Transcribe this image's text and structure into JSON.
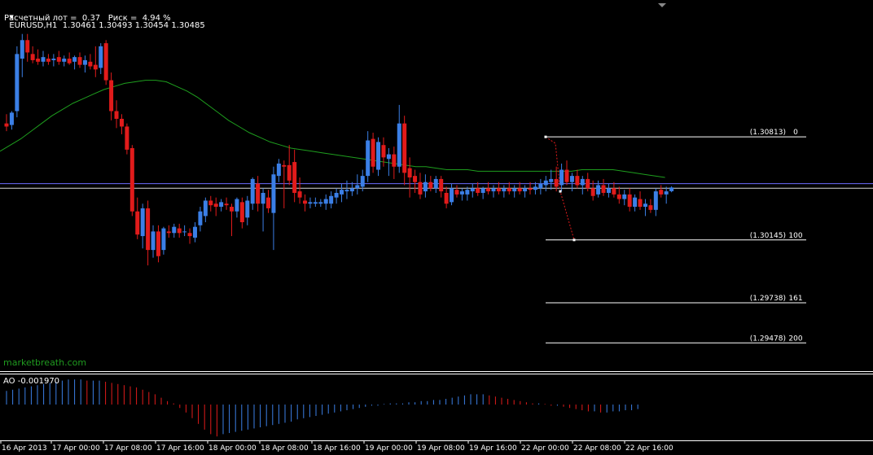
{
  "header": {
    "symbol_line": "EURUSD,H1  1.30461 1.30493 1.30454 1.30485",
    "risk_line": "Расчетный лот =  0.37   Риск =  4.94 %"
  },
  "watermark": "marketbreath.com",
  "indicator": {
    "label": "AO -0.001970"
  },
  "colors": {
    "background": "#000000",
    "bull": "#3b7fe6",
    "bear": "#e11b1b",
    "ma": "#1e9e1e",
    "hline_blue": "#6b6bff",
    "hline_white": "#d8d8d8",
    "grid": "#ffffff"
  },
  "chart_data": {
    "type": "candlestick",
    "symbol": "EURUSD",
    "timeframe": "H1",
    "current_ohlc": {
      "open": 1.30461,
      "high": 1.30493,
      "low": 1.30454,
      "close": 1.30485
    },
    "x_tick_labels": [
      "16 Apr 2013",
      "17 Apr 00:00",
      "17 Apr 08:00",
      "17 Apr 16:00",
      "18 Apr 00:00",
      "18 Apr 08:00",
      "18 Apr 16:00",
      "19 Apr 00:00",
      "19 Apr 08:00",
      "19 Apr 16:00",
      "22 Apr 00:00",
      "22 Apr 08:00",
      "22 Apr 16:00"
    ],
    "ylim": [
      1.293,
      1.317
    ],
    "candles": [
      {
        "o": 1.309,
        "h": 1.3096,
        "l": 1.3085,
        "c": 1.3088
      },
      {
        "o": 1.3089,
        "h": 1.3098,
        "l": 1.3086,
        "c": 1.3097
      },
      {
        "o": 1.3098,
        "h": 1.314,
        "l": 1.3094,
        "c": 1.3135
      },
      {
        "o": 1.3132,
        "h": 1.3148,
        "l": 1.312,
        "c": 1.3144
      },
      {
        "o": 1.3144,
        "h": 1.3148,
        "l": 1.313,
        "c": 1.3136
      },
      {
        "o": 1.3135,
        "h": 1.314,
        "l": 1.3129,
        "c": 1.3131
      },
      {
        "o": 1.3132,
        "h": 1.3138,
        "l": 1.3128,
        "c": 1.313
      },
      {
        "o": 1.313,
        "h": 1.3137,
        "l": 1.3127,
        "c": 1.3133
      },
      {
        "o": 1.3132,
        "h": 1.3135,
        "l": 1.3128,
        "c": 1.313
      },
      {
        "o": 1.3131,
        "h": 1.3135,
        "l": 1.3127,
        "c": 1.3132
      },
      {
        "o": 1.3133,
        "h": 1.3137,
        "l": 1.3128,
        "c": 1.313
      },
      {
        "o": 1.313,
        "h": 1.3134,
        "l": 1.3127,
        "c": 1.3132
      },
      {
        "o": 1.3132,
        "h": 1.3136,
        "l": 1.3128,
        "c": 1.3129
      },
      {
        "o": 1.313,
        "h": 1.3134,
        "l": 1.3125,
        "c": 1.3133
      },
      {
        "o": 1.3133,
        "h": 1.3136,
        "l": 1.3126,
        "c": 1.3128
      },
      {
        "o": 1.3128,
        "h": 1.3134,
        "l": 1.3123,
        "c": 1.3131
      },
      {
        "o": 1.313,
        "h": 1.3135,
        "l": 1.3125,
        "c": 1.3127
      },
      {
        "o": 1.3128,
        "h": 1.314,
        "l": 1.312,
        "c": 1.3125
      },
      {
        "o": 1.3126,
        "h": 1.3142,
        "l": 1.3122,
        "c": 1.314
      },
      {
        "o": 1.3142,
        "h": 1.3144,
        "l": 1.3115,
        "c": 1.3118
      },
      {
        "o": 1.3118,
        "h": 1.3123,
        "l": 1.3092,
        "c": 1.3098
      },
      {
        "o": 1.3098,
        "h": 1.3105,
        "l": 1.3087,
        "c": 1.3093
      },
      {
        "o": 1.3093,
        "h": 1.3096,
        "l": 1.3083,
        "c": 1.3088
      },
      {
        "o": 1.3088,
        "h": 1.309,
        "l": 1.307,
        "c": 1.3073
      },
      {
        "o": 1.3074,
        "h": 1.3076,
        "l": 1.303,
        "c": 1.3033
      },
      {
        "o": 1.3033,
        "h": 1.3042,
        "l": 1.3015,
        "c": 1.3018
      },
      {
        "o": 1.3017,
        "h": 1.3038,
        "l": 1.3009,
        "c": 1.3035
      },
      {
        "o": 1.3035,
        "h": 1.304,
        "l": 1.2998,
        "c": 1.3008
      },
      {
        "o": 1.3008,
        "h": 1.3024,
        "l": 1.3003,
        "c": 1.302
      },
      {
        "o": 1.302,
        "h": 1.3024,
        "l": 1.3,
        "c": 1.3004
      },
      {
        "o": 1.3008,
        "h": 1.3023,
        "l": 1.3005,
        "c": 1.3022
      },
      {
        "o": 1.302,
        "h": 1.3024,
        "l": 1.3016,
        "c": 1.3019
      },
      {
        "o": 1.3019,
        "h": 1.3025,
        "l": 1.3016,
        "c": 1.3023
      },
      {
        "o": 1.3022,
        "h": 1.3025,
        "l": 1.3016,
        "c": 1.3019
      },
      {
        "o": 1.302,
        "h": 1.3024,
        "l": 1.3017,
        "c": 1.302
      },
      {
        "o": 1.3019,
        "h": 1.3022,
        "l": 1.3012,
        "c": 1.3017
      },
      {
        "o": 1.3016,
        "h": 1.3026,
        "l": 1.3013,
        "c": 1.3023
      },
      {
        "o": 1.3024,
        "h": 1.3036,
        "l": 1.302,
        "c": 1.3033
      },
      {
        "o": 1.303,
        "h": 1.3042,
        "l": 1.3026,
        "c": 1.304
      },
      {
        "o": 1.304,
        "h": 1.3043,
        "l": 1.3033,
        "c": 1.3037
      },
      {
        "o": 1.3038,
        "h": 1.3042,
        "l": 1.303,
        "c": 1.3036
      },
      {
        "o": 1.3036,
        "h": 1.3041,
        "l": 1.3033,
        "c": 1.3039
      },
      {
        "o": 1.3038,
        "h": 1.3042,
        "l": 1.3034,
        "c": 1.3037
      },
      {
        "o": 1.3036,
        "h": 1.3038,
        "l": 1.3017,
        "c": 1.3033
      },
      {
        "o": 1.3033,
        "h": 1.3042,
        "l": 1.3029,
        "c": 1.3041
      },
      {
        "o": 1.3039,
        "h": 1.3042,
        "l": 1.3022,
        "c": 1.3026
      },
      {
        "o": 1.3029,
        "h": 1.3043,
        "l": 1.3024,
        "c": 1.304
      },
      {
        "o": 1.3038,
        "h": 1.3055,
        "l": 1.3034,
        "c": 1.3054
      },
      {
        "o": 1.3051,
        "h": 1.3056,
        "l": 1.3033,
        "c": 1.3038
      },
      {
        "o": 1.3038,
        "h": 1.3048,
        "l": 1.302,
        "c": 1.3045
      },
      {
        "o": 1.3042,
        "h": 1.3047,
        "l": 1.3032,
        "c": 1.3035
      },
      {
        "o": 1.3032,
        "h": 1.3062,
        "l": 1.3008,
        "c": 1.3057
      },
      {
        "o": 1.3056,
        "h": 1.3067,
        "l": 1.3052,
        "c": 1.3064
      },
      {
        "o": 1.3063,
        "h": 1.3066,
        "l": 1.3035,
        "c": 1.3062
      },
      {
        "o": 1.3063,
        "h": 1.3076,
        "l": 1.305,
        "c": 1.3053
      },
      {
        "o": 1.3065,
        "h": 1.3073,
        "l": 1.3039,
        "c": 1.3045
      },
      {
        "o": 1.3046,
        "h": 1.3055,
        "l": 1.3038,
        "c": 1.3042
      },
      {
        "o": 1.304,
        "h": 1.3044,
        "l": 1.3033,
        "c": 1.3038
      },
      {
        "o": 1.3038,
        "h": 1.3042,
        "l": 1.3035,
        "c": 1.3039
      },
      {
        "o": 1.3038,
        "h": 1.3042,
        "l": 1.3036,
        "c": 1.3039
      },
      {
        "o": 1.3038,
        "h": 1.3041,
        "l": 1.3036,
        "c": 1.3039
      },
      {
        "o": 1.3038,
        "h": 1.3044,
        "l": 1.3034,
        "c": 1.3041
      },
      {
        "o": 1.3038,
        "h": 1.3046,
        "l": 1.3035,
        "c": 1.3043
      },
      {
        "o": 1.3042,
        "h": 1.3048,
        "l": 1.3038,
        "c": 1.3045
      },
      {
        "o": 1.3044,
        "h": 1.3051,
        "l": 1.3039,
        "c": 1.3047
      },
      {
        "o": 1.3046,
        "h": 1.3053,
        "l": 1.3041,
        "c": 1.3047
      },
      {
        "o": 1.3046,
        "h": 1.3052,
        "l": 1.3043,
        "c": 1.3048
      },
      {
        "o": 1.3048,
        "h": 1.3057,
        "l": 1.3044,
        "c": 1.305
      },
      {
        "o": 1.3049,
        "h": 1.306,
        "l": 1.3046,
        "c": 1.3056
      },
      {
        "o": 1.3056,
        "h": 1.3085,
        "l": 1.3052,
        "c": 1.3079
      },
      {
        "o": 1.308,
        "h": 1.3084,
        "l": 1.3058,
        "c": 1.3062
      },
      {
        "o": 1.306,
        "h": 1.3081,
        "l": 1.3056,
        "c": 1.3078
      },
      {
        "o": 1.3076,
        "h": 1.3081,
        "l": 1.3062,
        "c": 1.3068
      },
      {
        "o": 1.3067,
        "h": 1.3074,
        "l": 1.3056,
        "c": 1.307
      },
      {
        "o": 1.307,
        "h": 1.3075,
        "l": 1.3054,
        "c": 1.3062
      },
      {
        "o": 1.3062,
        "h": 1.3102,
        "l": 1.3058,
        "c": 1.309
      },
      {
        "o": 1.309,
        "h": 1.3095,
        "l": 1.305,
        "c": 1.3058
      },
      {
        "o": 1.3061,
        "h": 1.3068,
        "l": 1.3042,
        "c": 1.3055
      },
      {
        "o": 1.3056,
        "h": 1.306,
        "l": 1.3045,
        "c": 1.3052
      },
      {
        "o": 1.3052,
        "h": 1.3058,
        "l": 1.3041,
        "c": 1.3044
      },
      {
        "o": 1.3046,
        "h": 1.3057,
        "l": 1.3042,
        "c": 1.3052
      },
      {
        "o": 1.3052,
        "h": 1.3056,
        "l": 1.3046,
        "c": 1.3048
      },
      {
        "o": 1.3048,
        "h": 1.3056,
        "l": 1.3045,
        "c": 1.3054
      },
      {
        "o": 1.3054,
        "h": 1.3056,
        "l": 1.3042,
        "c": 1.3046
      },
      {
        "o": 1.3045,
        "h": 1.3049,
        "l": 1.3035,
        "c": 1.3038
      },
      {
        "o": 1.3039,
        "h": 1.3051,
        "l": 1.3037,
        "c": 1.3048
      },
      {
        "o": 1.3047,
        "h": 1.305,
        "l": 1.3042,
        "c": 1.3044
      },
      {
        "o": 1.3044,
        "h": 1.3048,
        "l": 1.304,
        "c": 1.3046
      },
      {
        "o": 1.3044,
        "h": 1.3049,
        "l": 1.304,
        "c": 1.3047
      },
      {
        "o": 1.3046,
        "h": 1.3051,
        "l": 1.3042,
        "c": 1.3048
      },
      {
        "o": 1.3048,
        "h": 1.3052,
        "l": 1.3043,
        "c": 1.3045
      },
      {
        "o": 1.3045,
        "h": 1.3049,
        "l": 1.3041,
        "c": 1.3048
      },
      {
        "o": 1.3048,
        "h": 1.3052,
        "l": 1.3044,
        "c": 1.3046
      },
      {
        "o": 1.3046,
        "h": 1.305,
        "l": 1.3042,
        "c": 1.3048
      },
      {
        "o": 1.3048,
        "h": 1.3052,
        "l": 1.3044,
        "c": 1.3046
      },
      {
        "o": 1.3046,
        "h": 1.305,
        "l": 1.3042,
        "c": 1.3048
      },
      {
        "o": 1.3048,
        "h": 1.3052,
        "l": 1.3044,
        "c": 1.3046
      },
      {
        "o": 1.3046,
        "h": 1.305,
        "l": 1.3042,
        "c": 1.3048
      },
      {
        "o": 1.3048,
        "h": 1.3052,
        "l": 1.3044,
        "c": 1.3046
      },
      {
        "o": 1.3046,
        "h": 1.305,
        "l": 1.3042,
        "c": 1.3048
      },
      {
        "o": 1.3048,
        "h": 1.3052,
        "l": 1.3044,
        "c": 1.3047
      },
      {
        "o": 1.3047,
        "h": 1.3052,
        "l": 1.3044,
        "c": 1.3049
      },
      {
        "o": 1.3048,
        "h": 1.3054,
        "l": 1.3044,
        "c": 1.3051
      },
      {
        "o": 1.305,
        "h": 1.3056,
        "l": 1.3046,
        "c": 1.3053
      },
      {
        "o": 1.3052,
        "h": 1.306,
        "l": 1.3047,
        "c": 1.3054
      },
      {
        "o": 1.3054,
        "h": 1.3062,
        "l": 1.3046,
        "c": 1.3049
      },
      {
        "o": 1.305,
        "h": 1.3064,
        "l": 1.3046,
        "c": 1.306
      },
      {
        "o": 1.306,
        "h": 1.3066,
        "l": 1.305,
        "c": 1.3052
      },
      {
        "o": 1.3052,
        "h": 1.3058,
        "l": 1.3046,
        "c": 1.3056
      },
      {
        "o": 1.3056,
        "h": 1.306,
        "l": 1.3048,
        "c": 1.305
      },
      {
        "o": 1.305,
        "h": 1.3056,
        "l": 1.3044,
        "c": 1.3054
      },
      {
        "o": 1.3054,
        "h": 1.3058,
        "l": 1.3046,
        "c": 1.3048
      },
      {
        "o": 1.3048,
        "h": 1.3053,
        "l": 1.304,
        "c": 1.3043
      },
      {
        "o": 1.3044,
        "h": 1.3053,
        "l": 1.3042,
        "c": 1.305
      },
      {
        "o": 1.305,
        "h": 1.3054,
        "l": 1.3043,
        "c": 1.3045
      },
      {
        "o": 1.3045,
        "h": 1.3051,
        "l": 1.3042,
        "c": 1.3048
      },
      {
        "o": 1.3048,
        "h": 1.3052,
        "l": 1.3042,
        "c": 1.3044
      },
      {
        "o": 1.3044,
        "h": 1.3049,
        "l": 1.3038,
        "c": 1.3041
      },
      {
        "o": 1.3041,
        "h": 1.3047,
        "l": 1.3037,
        "c": 1.3044
      },
      {
        "o": 1.3044,
        "h": 1.3048,
        "l": 1.3033,
        "c": 1.3036
      },
      {
        "o": 1.3036,
        "h": 1.3044,
        "l": 1.3033,
        "c": 1.3042
      },
      {
        "o": 1.3041,
        "h": 1.3046,
        "l": 1.3034,
        "c": 1.3036
      },
      {
        "o": 1.3036,
        "h": 1.3041,
        "l": 1.303,
        "c": 1.3038
      },
      {
        "o": 1.3037,
        "h": 1.3041,
        "l": 1.3032,
        "c": 1.3034
      },
      {
        "o": 1.3034,
        "h": 1.3048,
        "l": 1.303,
        "c": 1.3046
      },
      {
        "o": 1.3047,
        "h": 1.305,
        "l": 1.3042,
        "c": 1.3044
      },
      {
        "o": 1.3044,
        "h": 1.3049,
        "l": 1.3038,
        "c": 1.3046
      },
      {
        "o": 1.30461,
        "h": 1.30493,
        "l": 1.30454,
        "c": 1.30485
      }
    ],
    "moving_average": [
      1.3072,
      1.3076,
      1.308,
      1.3085,
      1.309,
      1.3095,
      1.3099,
      1.3103,
      1.3106,
      1.3109,
      1.3112,
      1.3114,
      1.3116,
      1.3117,
      1.3118,
      1.3118,
      1.3117,
      1.3114,
      1.3111,
      1.3107,
      1.3102,
      1.3097,
      1.3092,
      1.3088,
      1.3084,
      1.3081,
      1.3078,
      1.3076,
      1.3074,
      1.3073,
      1.3072,
      1.3071,
      1.307,
      1.3069,
      1.3068,
      1.3067,
      1.3066,
      1.3065,
      1.3064,
      1.3063,
      1.3062,
      1.3062,
      1.3061,
      1.306,
      1.306,
      1.306,
      1.3059,
      1.3059,
      1.3059,
      1.3059,
      1.3059,
      1.3059,
      1.3059,
      1.3059,
      1.3059,
      1.3059,
      1.306,
      1.306,
      1.306,
      1.306,
      1.3059,
      1.3058,
      1.3057,
      1.3056,
      1.3055
    ],
    "fibonacci_levels": [
      {
        "price_label": "(1.30813)",
        "level_label": "0"
      },
      {
        "price_label": "(1.30145)",
        "level_label": "100"
      },
      {
        "price_label": "(1.29738)",
        "level_label": "161"
      },
      {
        "price_label": "(1.29478)",
        "level_label": "200"
      }
    ],
    "fibonacci_prices": [
      1.30813,
      1.30145,
      1.29738,
      1.29478
    ],
    "horizontal_lines": [
      1.3051,
      1.3048
    ],
    "ao_values": [
      0.0012,
      0.0013,
      0.0014,
      0.0015,
      0.0016,
      0.0017,
      0.0018,
      0.0019,
      0.002,
      0.0021,
      0.0022,
      0.0022,
      0.0022,
      0.0021,
      0.0021,
      0.0021,
      0.002,
      0.0019,
      0.0018,
      0.0017,
      0.0016,
      0.0015,
      0.0013,
      0.0011,
      0.0009,
      0.0006,
      0.0003,
      0.0001,
      -0.0003,
      -0.0007,
      -0.0012,
      -0.0017,
      -0.0022,
      -0.0026,
      -0.0028,
      -0.0026,
      -0.0025,
      -0.0024,
      -0.0023,
      -0.0022,
      -0.0021,
      -0.002,
      -0.0019,
      -0.0018,
      -0.0017,
      -0.0016,
      -0.0015,
      -0.0013,
      -0.0012,
      -0.0011,
      -0.001,
      -0.0009,
      -0.0008,
      -0.0007,
      -0.0006,
      -0.0005,
      -0.0004,
      -0.0003,
      -0.0002,
      -0.0001,
      -0.0001,
      5e-05,
      0.0001,
      0.0001,
      0.0001,
      0.0002,
      0.0002,
      0.0003,
      0.0003,
      0.0004,
      0.0004,
      0.0005,
      0.0006,
      0.0007,
      0.0008,
      0.0009,
      0.0009,
      0.0009,
      0.0008,
      0.0007,
      0.0006,
      0.0005,
      0.0004,
      0.0003,
      0.0002,
      0.0001,
      0.0001,
      5e-05,
      -0.0001,
      -0.0001,
      -0.0002,
      -0.0003,
      -0.0004,
      -0.0005,
      -0.0006,
      -0.0006,
      -0.0007,
      -0.0007,
      -0.0006,
      -0.0006,
      -0.0005,
      -0.0005,
      -0.0004
    ]
  }
}
